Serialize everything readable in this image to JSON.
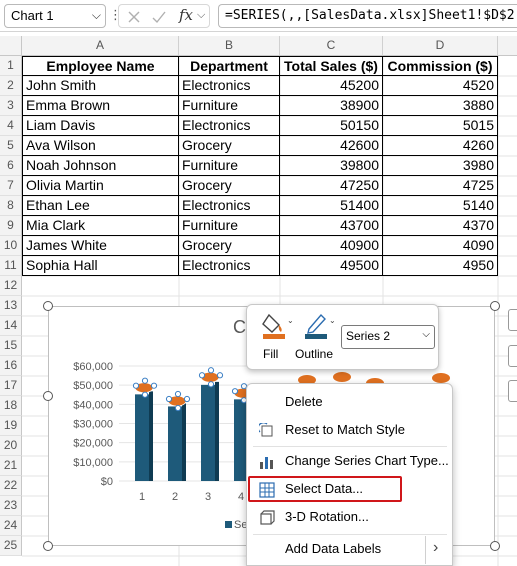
{
  "formula_bar": {
    "name_box": "Chart 1",
    "fx_label": "fx",
    "formula": "=SERIES(,,[SalesData.xlsx]Sheet1!$D$2:$D$11,2)"
  },
  "columns": [
    "A",
    "B",
    "C",
    "D"
  ],
  "rows": [
    "1",
    "2",
    "3",
    "4",
    "5",
    "6",
    "7",
    "8",
    "9",
    "10",
    "11",
    "12",
    "13",
    "14",
    "15",
    "16",
    "17",
    "18",
    "19",
    "20",
    "21",
    "22",
    "23",
    "24",
    "25"
  ],
  "table": {
    "headers": [
      "Employee Name",
      "Department",
      "Total Sales ($)",
      "Commission ($)"
    ],
    "data": [
      [
        "John Smith",
        "Electronics",
        "45200",
        "4520"
      ],
      [
        "Emma Brown",
        "Furniture",
        "38900",
        "3880"
      ],
      [
        "Liam Davis",
        "Electronics",
        "50150",
        "5015"
      ],
      [
        "Ava Wilson",
        "Grocery",
        "42600",
        "4260"
      ],
      [
        "Noah Johnson",
        "Furniture",
        "39800",
        "3980"
      ],
      [
        "Olivia Martin",
        "Grocery",
        "47250",
        "4725"
      ],
      [
        "Ethan Lee",
        "Electronics",
        "51400",
        "5140"
      ],
      [
        "Mia Clark",
        "Furniture",
        "43700",
        "4370"
      ],
      [
        "James White",
        "Grocery",
        "40900",
        "4090"
      ],
      [
        "Sophia Hall",
        "Electronics",
        "49500",
        "4950"
      ]
    ]
  },
  "chart": {
    "title_fragment": "C",
    "legend_fragment": "Se",
    "colors": {
      "series1": "#1e5a7a",
      "series2": "#e07020"
    }
  },
  "chart_data": {
    "type": "bar",
    "categories": [
      "1",
      "2",
      "3",
      "4"
    ],
    "y_ticks": [
      "$60,000",
      "$50,000",
      "$40,000",
      "$30,000",
      "$20,000",
      "$10,000",
      "$0"
    ],
    "ylim": [
      0,
      60000
    ],
    "series": [
      {
        "values": [
          45200,
          38900,
          50150,
          42600
        ]
      },
      {
        "values": [
          4520,
          3880,
          5015,
          4260
        ]
      }
    ]
  },
  "mini_toolbar": {
    "fill_label": "Fill",
    "outline_label": "Outline",
    "series_selected": "Series 2"
  },
  "context_menu": {
    "items": [
      {
        "label": "Delete",
        "icon": "delete-icon"
      },
      {
        "label": "Reset to Match Style",
        "icon": "reset-style-icon"
      },
      {
        "label": "Change Series Chart Type...",
        "icon": "chart-type-icon"
      },
      {
        "label": "Select Data...",
        "icon": "select-data-icon"
      },
      {
        "label": "3-D Rotation...",
        "icon": "rotation-icon"
      },
      {
        "label": "Add Data Labels",
        "icon": "data-labels-icon"
      }
    ],
    "submenu_arrow": "›"
  }
}
